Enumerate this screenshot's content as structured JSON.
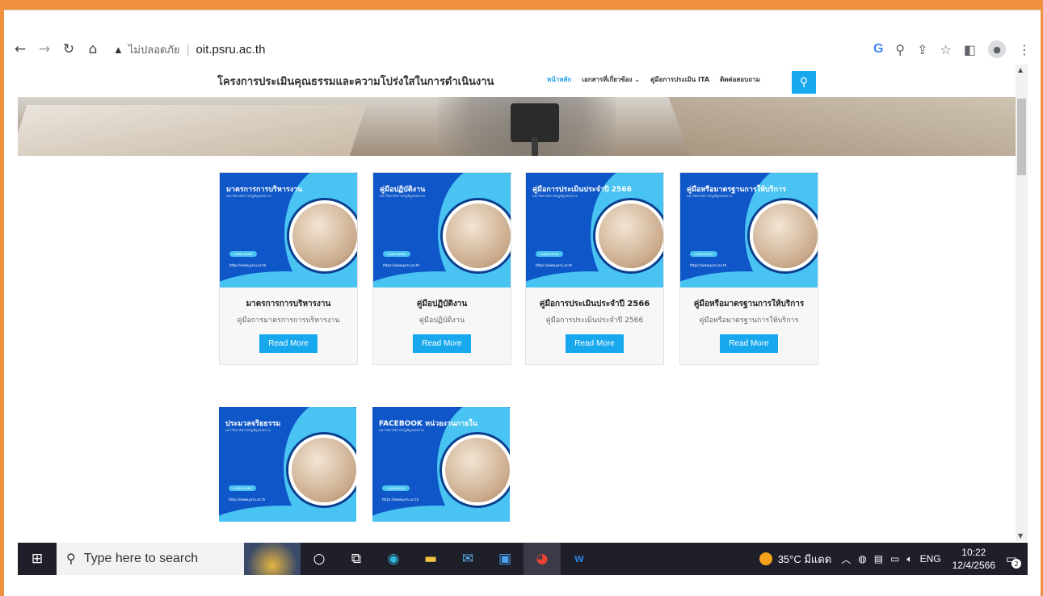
{
  "browser": {
    "url_warning": "▲",
    "insecure_label": "ไม่ปลอดภัย",
    "url": "oit.psru.ac.th",
    "icons": [
      "back-icon",
      "forward-icon",
      "reload-icon",
      "home-icon",
      "google-icon",
      "zoom-icon",
      "share-icon",
      "star-icon",
      "sidepanel-icon",
      "profile-icon",
      "menu-icon"
    ]
  },
  "site": {
    "title": "โครงการประเมินคุณธรรมและความโปร่งใสในการดำเนินงาน",
    "nav": [
      "หน้าหลัก",
      "เอกสารที่เกี่ยวข้อง ⌄",
      "คู่มือการประเมิน ITA",
      "ติดต่อสอบถาม"
    ]
  },
  "cards": [
    {
      "thumb_title": "มาตรการการบริหารงาน",
      "thumb_sub": "มหาวิทยาลัยราชภัฏพิบูลสงคราม",
      "learn_more": "LEARN MORE",
      "thumb_url": "https://www.psru.ac.th",
      "title": "มาตรการการบริหารงาน",
      "desc": "คู่มือการมาตรการการบริหารงาน",
      "button": "Read More"
    },
    {
      "thumb_title": "คู่มือปฏิบัติงาน",
      "thumb_sub": "มหาวิทยาลัยราชภัฏพิบูลสงคราม",
      "learn_more": "LEARN MORE",
      "thumb_url": "https://www.psru.ac.th",
      "title": "คู่มือปฏิบัติงาน",
      "desc": "คู่มือปฏิบัติงาน",
      "button": "Read More"
    },
    {
      "thumb_title": "คู่มือการประเมินประจำปี 2566",
      "thumb_sub": "มหาวิทยาลัยราชภัฏพิบูลสงคราม",
      "learn_more": "LEARN MORE",
      "thumb_url": "https://www.psru.ac.th",
      "title": "คู่มือการประเมินประจำปี 2566",
      "desc": "คู่มือการประเมินประจำปี 2566",
      "button": "Read More"
    },
    {
      "thumb_title": "คู่มือหรือมาตรฐานการให้บริการ",
      "thumb_sub": "มหาวิทยาลัยราชภัฏพิบูลสงคราม",
      "learn_more": "LEARN MORE",
      "thumb_url": "https://www.psru.ac.th",
      "title": "คู่มือหรือมาตรฐานการให้บริการ",
      "desc": "คู่มือหรือมาตรฐานการให้บริการ",
      "button": "Read More"
    },
    {
      "thumb_title": "ประมวลจริยธรรม",
      "thumb_sub": "มหาวิทยาลัยราชภัฏพิบูลสงคราม",
      "learn_more": "LEARN MORE",
      "thumb_url": "https://www.psru.ac.th"
    },
    {
      "thumb_title": "FACEBOOK หน่วยงานภายใน",
      "thumb_sub": "มหาวิทยาลัยราชภัฏพิบูลสงคราม",
      "learn_more": "LEARN MORE",
      "thumb_url": "https://www.psru.ac.th"
    }
  ],
  "taskbar": {
    "search_placeholder": "Type here to search",
    "weather": "35°C มีแดด",
    "lang": "ENG",
    "time": "10:22",
    "date": "12/4/2566",
    "notifications": "2"
  },
  "colors": {
    "accent": "#18a8ee",
    "frame": "#f0913e",
    "card_blue": "#0f57c9",
    "card_light": "#49c3f1"
  }
}
